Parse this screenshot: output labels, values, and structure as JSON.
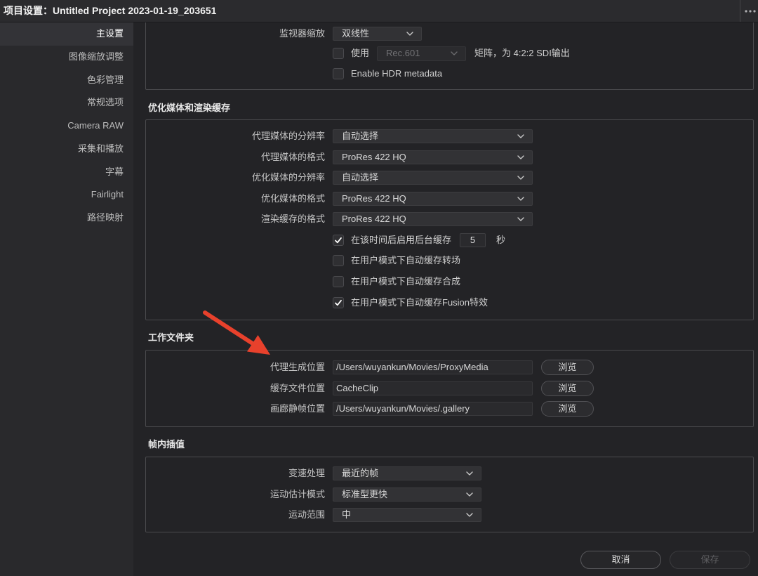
{
  "window": {
    "title": "项目设置：Untitled Project 2023-01-19_203651"
  },
  "icons": {
    "more": "more-horizontal-icon",
    "dropdown": "chevron-down-icon",
    "check": "checkmark-icon",
    "annotation": "red-arrow-annotation"
  },
  "colors": {
    "window_bg": "#232326",
    "sidebar_bg": "#29292c",
    "panel_border": "#4a4a4d",
    "annotation_arrow": "#e8412c"
  },
  "sidebar": {
    "items": [
      {
        "label": "主设置",
        "selected": true
      },
      {
        "label": "图像缩放调整",
        "selected": false
      },
      {
        "label": "色彩管理",
        "selected": false
      },
      {
        "label": "常规选项",
        "selected": false
      },
      {
        "label": "Camera RAW",
        "selected": false
      },
      {
        "label": "采集和播放",
        "selected": false
      },
      {
        "label": "字幕",
        "selected": false
      },
      {
        "label": "Fairlight",
        "selected": false
      },
      {
        "label": "路径映射",
        "selected": false
      }
    ]
  },
  "monitor": {
    "scaling_label": "监视器缩放",
    "scaling_value": "双线性",
    "use_matrix": {
      "label": "使用",
      "checked": false,
      "value": "Rec.601",
      "disabled": true,
      "suffix": "矩阵，为 4:2:2 SDI输出"
    },
    "hdr_metadata": {
      "label": "Enable HDR metadata",
      "checked": false
    }
  },
  "cache": {
    "heading": "优化媒体和渲染缓存",
    "fields": [
      {
        "label": "代理媒体的分辨率",
        "value": "自动选择"
      },
      {
        "label": "代理媒体的格式",
        "value": "ProRes 422 HQ"
      },
      {
        "label": "优化媒体的分辨率",
        "value": "自动选择"
      },
      {
        "label": "优化媒体的格式",
        "value": "ProRes 422 HQ"
      },
      {
        "label": "渲染缓存的格式",
        "value": "ProRes 422 HQ"
      }
    ],
    "background_cache": {
      "label": "在该时间后启用后台缓存",
      "checked": true,
      "seconds": "5",
      "unit": "秒"
    },
    "options": [
      {
        "label": "在用户模式下自动缓存转场",
        "checked": false
      },
      {
        "label": "在用户模式下自动缓存合成",
        "checked": false
      },
      {
        "label": "在用户模式下自动缓存Fusion特效",
        "checked": true
      }
    ]
  },
  "working_folders": {
    "heading": "工作文件夹",
    "browse_label": "浏览",
    "rows": [
      {
        "label": "代理生成位置",
        "path": "/Users/wuyankun/Movies/ProxyMedia"
      },
      {
        "label": "缓存文件位置",
        "path": "CacheClip"
      },
      {
        "label": "画廊静帧位置",
        "path": "/Users/wuyankun/Movies/.gallery"
      }
    ]
  },
  "frame_interpolation": {
    "heading": "帧内插值",
    "fields": [
      {
        "label": "变速处理",
        "value": "最近的帧"
      },
      {
        "label": "运动估计模式",
        "value": "标准型更快"
      },
      {
        "label": "运动范围",
        "value": "中"
      }
    ]
  },
  "footer": {
    "cancel_label": "取消",
    "save_label": "保存",
    "save_disabled": true
  }
}
